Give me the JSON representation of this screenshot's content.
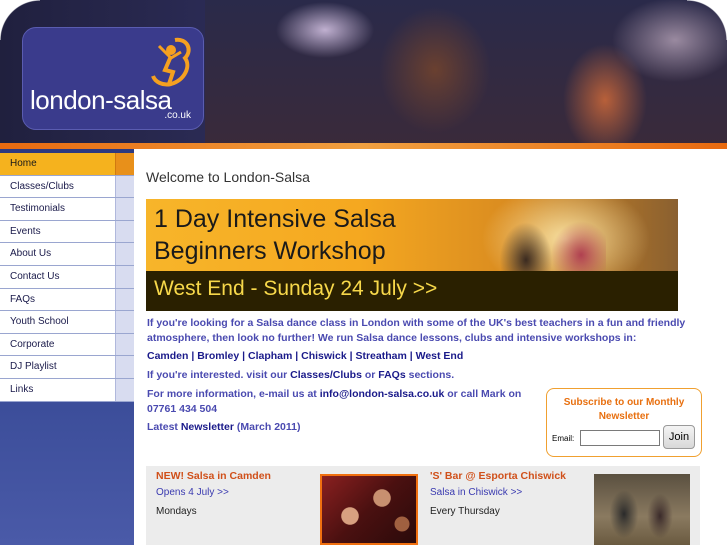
{
  "logo": {
    "text": "london-salsa",
    "sub": ".co.uk"
  },
  "nav": [
    {
      "label": "Home",
      "active": true
    },
    {
      "label": "Classes/Clubs"
    },
    {
      "label": "Testimonials"
    },
    {
      "label": "Events"
    },
    {
      "label": "About Us"
    },
    {
      "label": "Contact Us"
    },
    {
      "label": "FAQs"
    },
    {
      "label": "Youth School"
    },
    {
      "label": "Corporate"
    },
    {
      "label": "DJ Playlist"
    },
    {
      "label": "Links"
    }
  ],
  "main": {
    "welcome": "Welcome to London-Salsa",
    "banner": {
      "line1": "1 Day Intensive Salsa",
      "line2": "Beginners Workshop",
      "line3": "West End - Sunday 24 July >>"
    },
    "intro": "If you're looking for a Salsa dance class in London with some of the UK's best teachers in a fun and friendly atmosphere, then look no further! We run Salsa dance lessons, clubs and intensive workshops in:",
    "locations": [
      "Camden",
      "Bromley",
      "Clapham",
      "Chiswick",
      "Streatham",
      "West End"
    ],
    "interest": {
      "prefix": "If you're interested. visit our ",
      "link1": "Classes/Clubs",
      "mid": " or ",
      "link2": "FAQs",
      "suffix": " sections."
    },
    "contact": {
      "prefix": "For more information, e-mail us at ",
      "email": "info@london-salsa.co.uk",
      "suffix": " or call Mark on 07761 434 504"
    },
    "newsletter": {
      "prefix": "Latest ",
      "link": "Newsletter",
      "suffix": " (March 2011)"
    }
  },
  "subscribe": {
    "title": "Subscribe to our Monthly Newsletter",
    "email_label": "Email:",
    "email_value": "",
    "button": "Join"
  },
  "events": [
    {
      "title": "NEW! Salsa in Camden",
      "link": "Opens 4 July >>",
      "day": "Mondays"
    },
    {
      "title": "'S' Bar @ Esporta Chiswick",
      "link": "Salsa in Chiswick >>",
      "day": "Every Thursday"
    }
  ],
  "colors": {
    "accent": "#f5b21e",
    "link": "#1a1a8a",
    "text_blue": "#4a4ab0",
    "event_title": "#d0501a"
  }
}
